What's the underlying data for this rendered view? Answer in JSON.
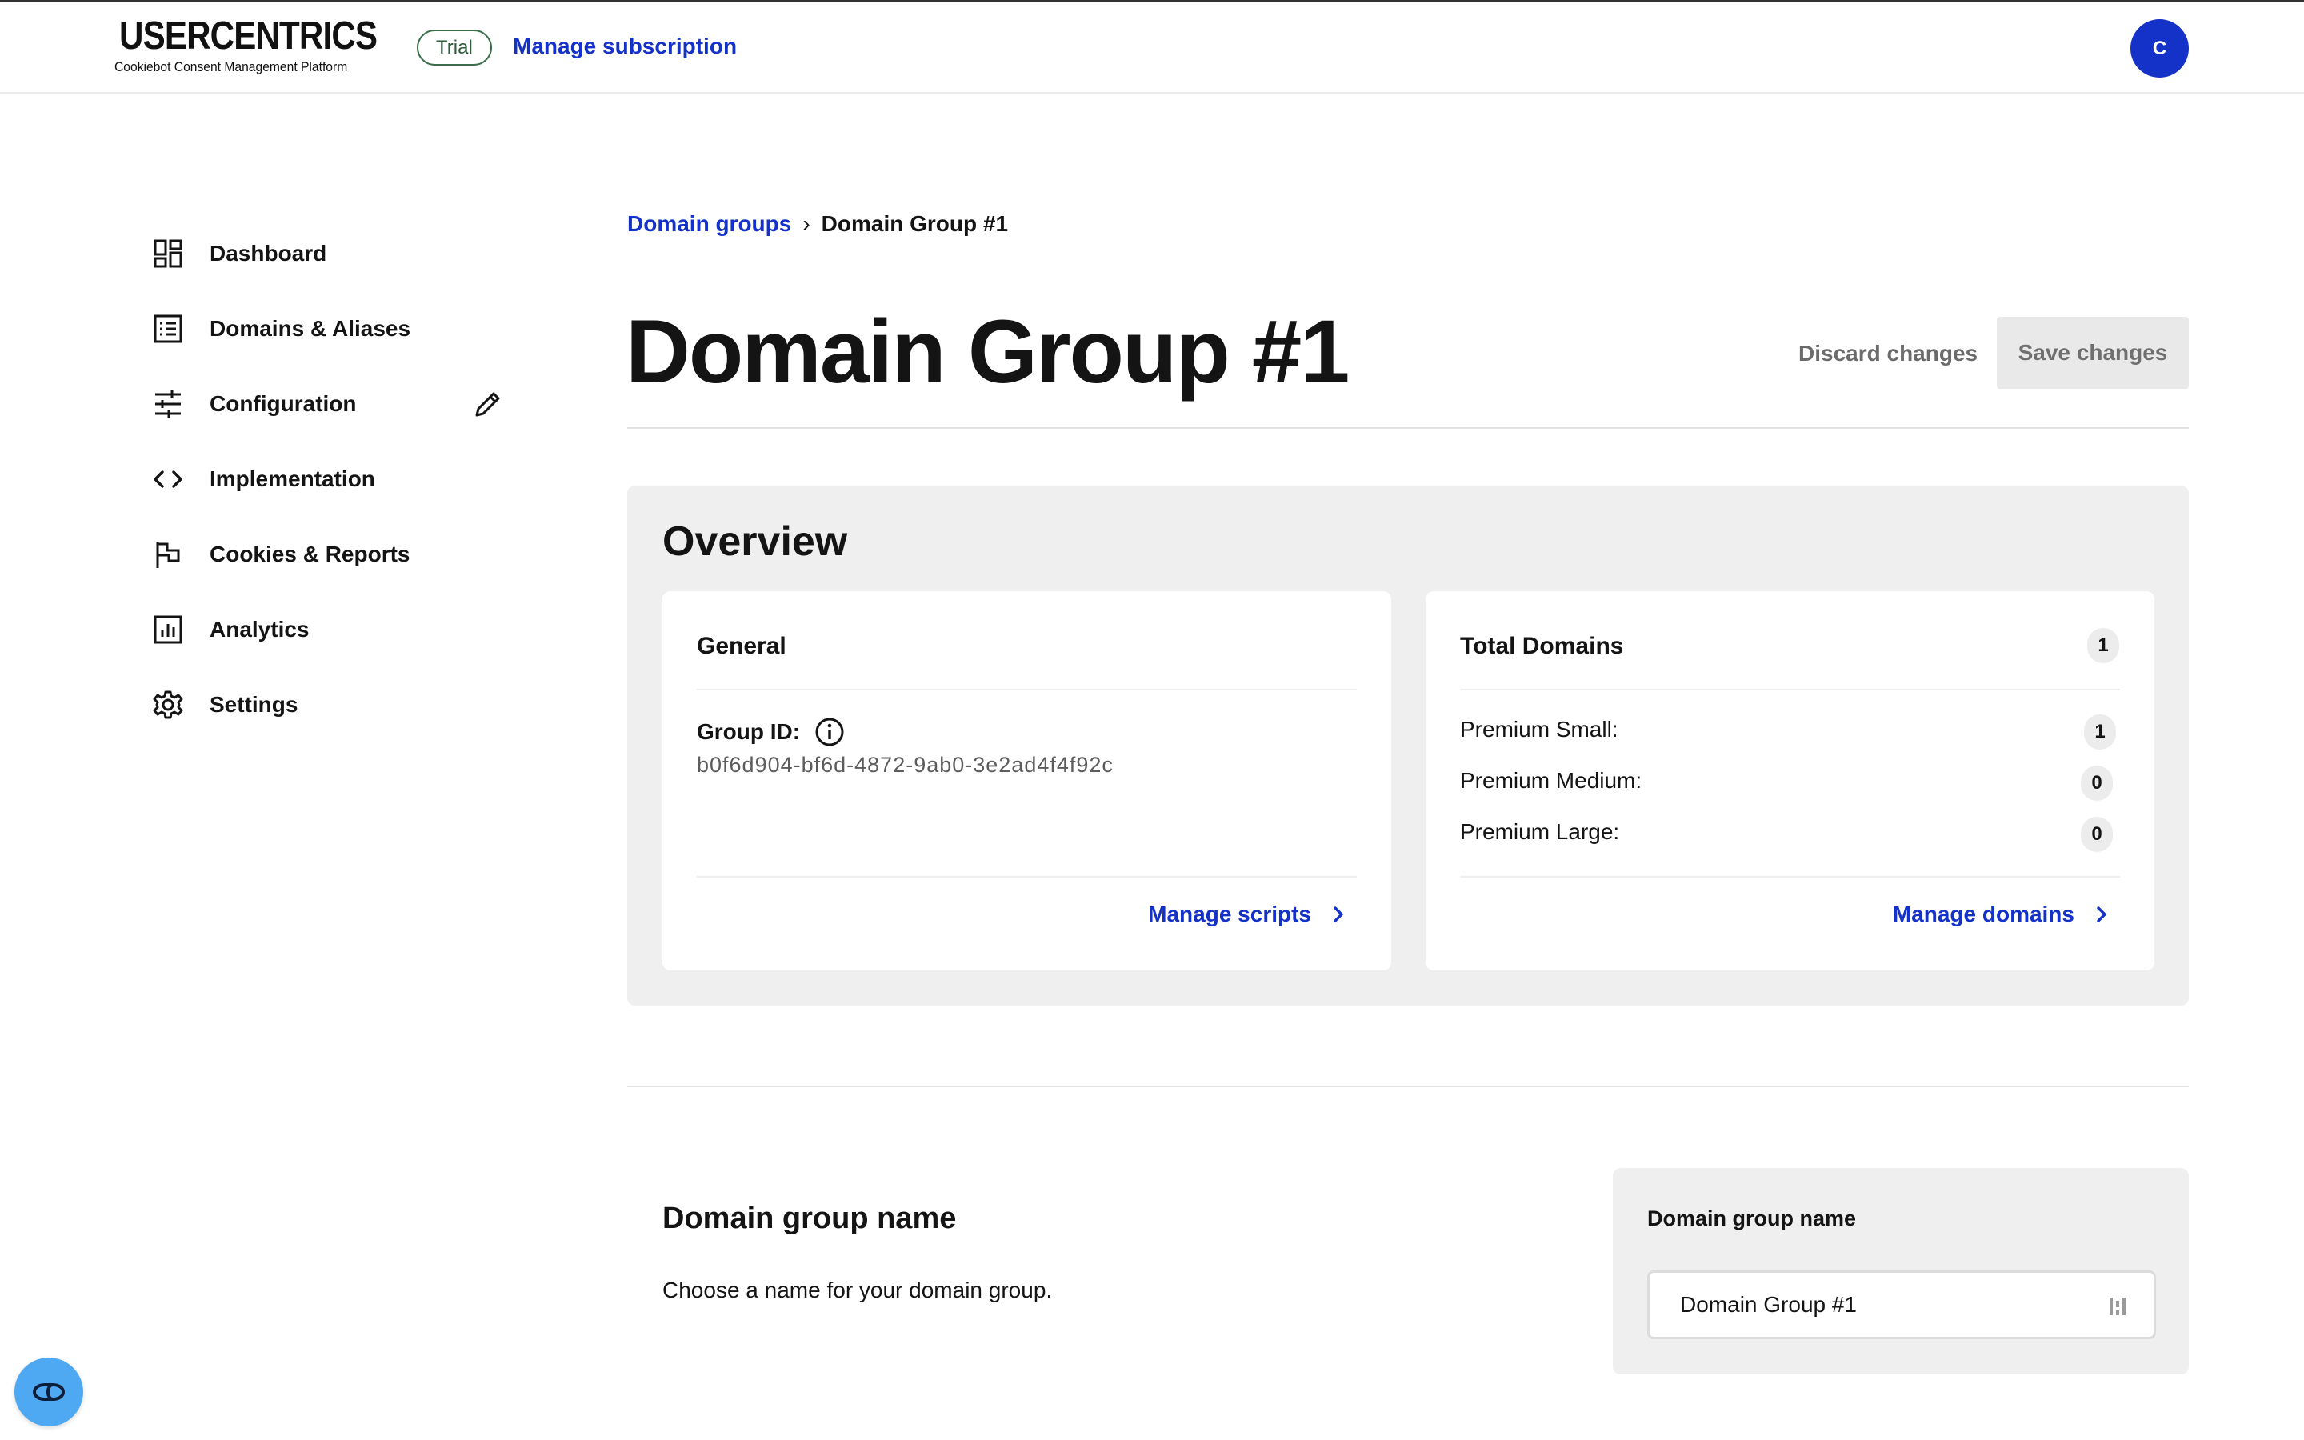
{
  "brand": {
    "name": "USERCENTRICS",
    "subtitle": "Cookiebot Consent Management Platform"
  },
  "topbar": {
    "trial_badge": "Trial",
    "manage_subscription": "Manage subscription",
    "avatar_initial": "C",
    "accent_color": "#1432c8"
  },
  "sidebar": {
    "items": [
      {
        "label": "Dashboard",
        "icon": "dashboard-icon"
      },
      {
        "label": "Domains & Aliases",
        "icon": "list-icon"
      },
      {
        "label": "Configuration",
        "icon": "sliders-icon",
        "edit_icon": "pencil-icon"
      },
      {
        "label": "Implementation",
        "icon": "code-icon"
      },
      {
        "label": "Cookies & Reports",
        "icon": "flag-icon"
      },
      {
        "label": "Analytics",
        "icon": "bar-chart-icon"
      },
      {
        "label": "Settings",
        "icon": "gear-icon"
      }
    ]
  },
  "breadcrumb": {
    "parent": "Domain groups",
    "separator": "›",
    "current": "Domain Group #1"
  },
  "header": {
    "title": "Domain Group #1",
    "discard_label": "Discard changes",
    "save_label": "Save changes"
  },
  "overview": {
    "title": "Overview",
    "general": {
      "title": "General",
      "group_id_label": "Group ID:",
      "group_id_value": "b0f6d904-bf6d-4872-9ab0-3e2ad4f4f92c",
      "link_label": "Manage scripts"
    },
    "domains": {
      "title": "Total Domains",
      "total": "1",
      "rows": [
        {
          "label": "Premium Small:",
          "count": "1"
        },
        {
          "label": "Premium Medium:",
          "count": "0"
        },
        {
          "label": "Premium Large:",
          "count": "0"
        }
      ],
      "link_label": "Manage domains"
    }
  },
  "name_section": {
    "title": "Domain group name",
    "description": "Choose a name for your domain group.",
    "field_label": "Domain group name",
    "field_value": "Domain Group #1"
  },
  "fab": {
    "icon": "cookie-consent-icon"
  }
}
